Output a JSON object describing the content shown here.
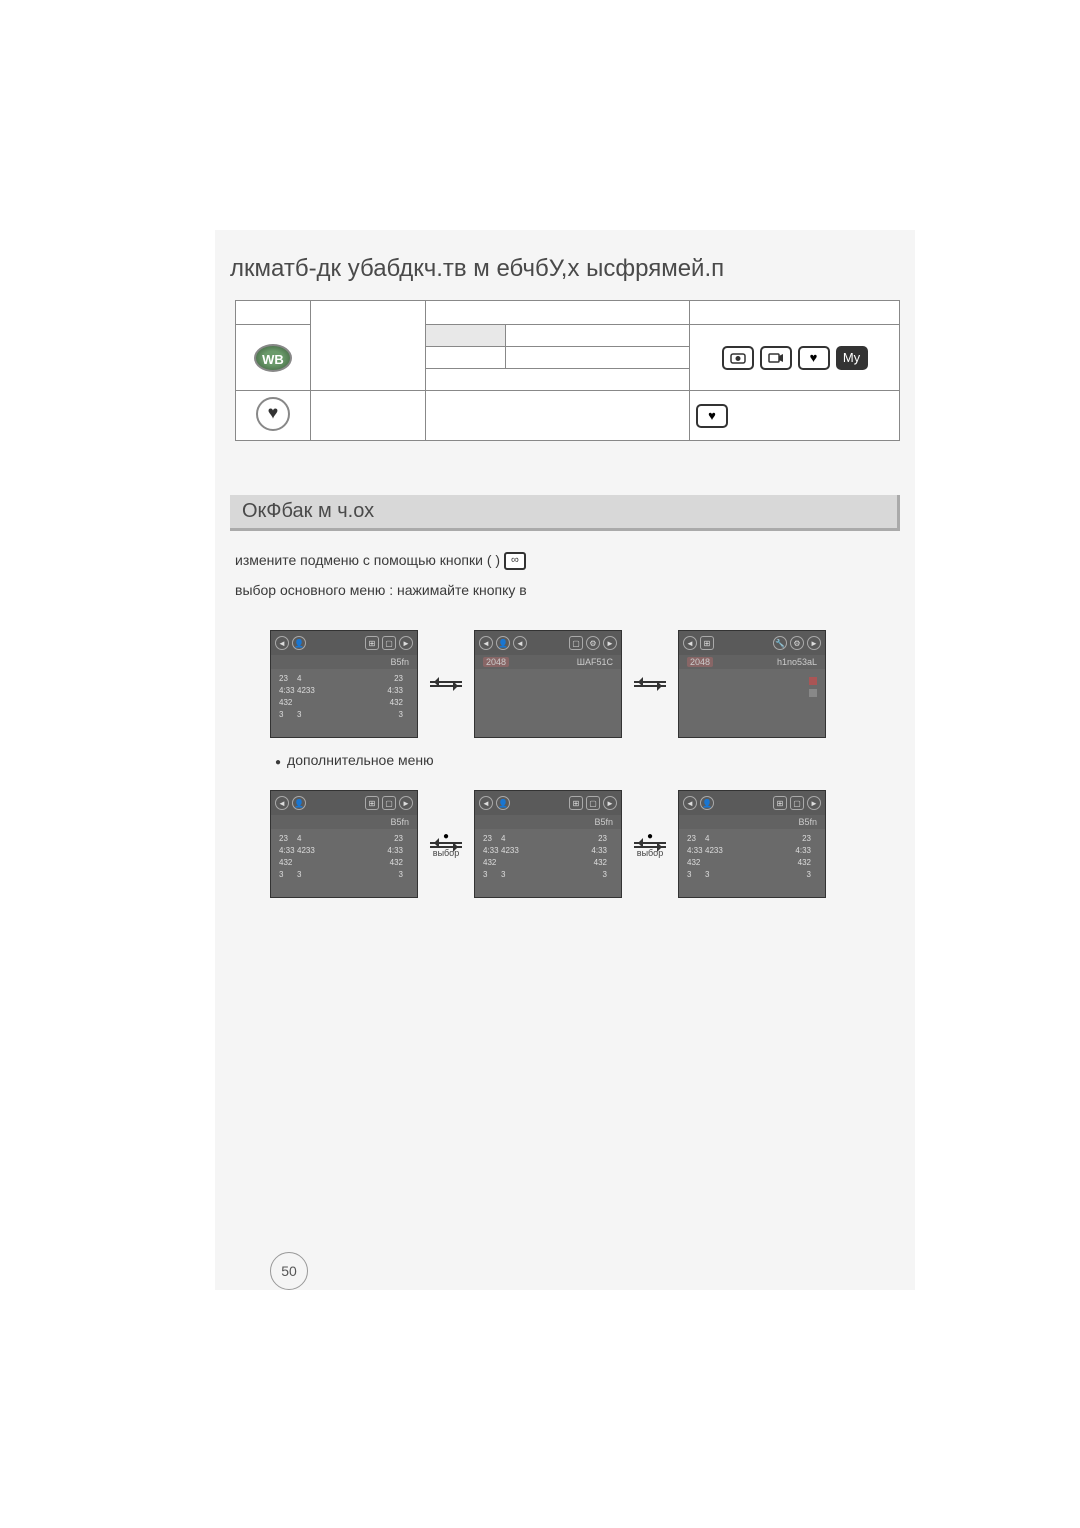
{
  "page": {
    "title": "лкматб-дк убабдкч.тв м ебчбУ,х ысфрямей.п",
    "section_title": "ОкФбак м ч.ох",
    "page_number": "50"
  },
  "table": {
    "wb_label": "WB",
    "my_label": "My"
  },
  "body": {
    "line1": "измените подменю с помощью кнопки (           )",
    "line2": "выбор основного меню : нажимайте кнопку в",
    "bullet1": "дополнительное меню",
    "step1": "выбор",
    "step2": "выбор"
  },
  "screens": {
    "tab_label": "B5fn",
    "tab_label2": "ШАF51C",
    "tab_label3": "h1no53aL",
    "badge": "2048",
    "rows": [
      {
        "c1": "23",
        "c2": "4",
        "c3": "23"
      },
      {
        "c1": "4:33",
        "c2": "4233",
        "c3": "4:33"
      },
      {
        "c1": "432",
        "c2": "",
        "c3": "432"
      },
      {
        "c1": "3",
        "c2": "3",
        "c3": "3"
      }
    ]
  }
}
